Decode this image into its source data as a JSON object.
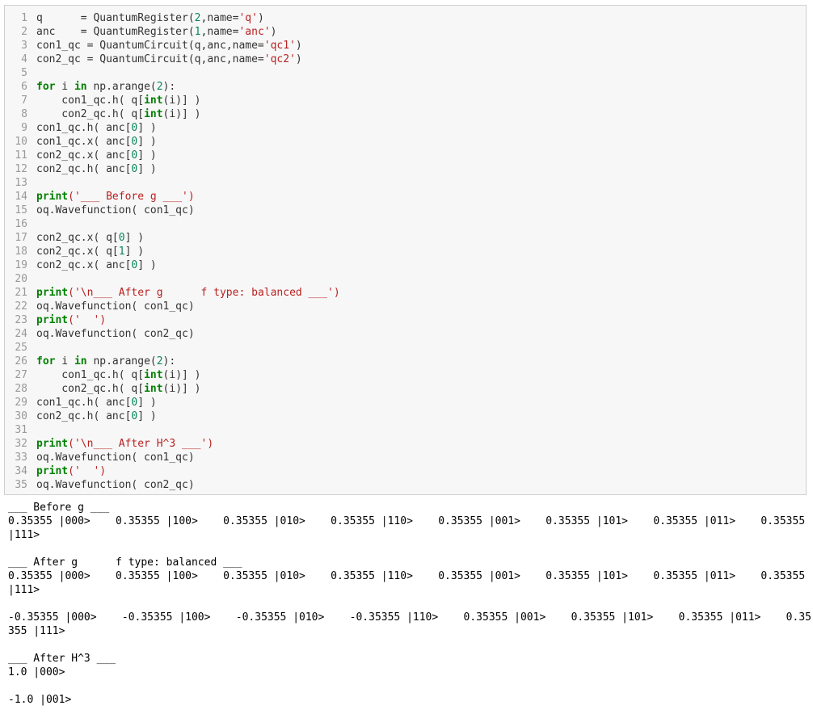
{
  "code_cell": {
    "lines": [
      {
        "n": "1",
        "tokens": [
          {
            "t": "q      = QuantumRegister(",
            "c": ""
          },
          {
            "t": "2",
            "c": "num"
          },
          {
            "t": ",name=",
            "c": ""
          },
          {
            "t": "'q'",
            "c": "str"
          },
          {
            "t": ")",
            "c": ""
          }
        ]
      },
      {
        "n": "2",
        "tokens": [
          {
            "t": "anc    = QuantumRegister(",
            "c": ""
          },
          {
            "t": "1",
            "c": "num"
          },
          {
            "t": ",name=",
            "c": ""
          },
          {
            "t": "'anc'",
            "c": "str"
          },
          {
            "t": ")",
            "c": ""
          }
        ]
      },
      {
        "n": "3",
        "tokens": [
          {
            "t": "con1_qc = QuantumCircuit(q,anc,name=",
            "c": ""
          },
          {
            "t": "'qc1'",
            "c": "str"
          },
          {
            "t": ")",
            "c": ""
          }
        ]
      },
      {
        "n": "4",
        "tokens": [
          {
            "t": "con2_qc = QuantumCircuit(q,anc,name=",
            "c": ""
          },
          {
            "t": "'qc2'",
            "c": "str"
          },
          {
            "t": ")",
            "c": ""
          }
        ]
      },
      {
        "n": "5",
        "tokens": []
      },
      {
        "n": "6",
        "tokens": [
          {
            "t": "for",
            "c": "kw"
          },
          {
            "t": " i ",
            "c": ""
          },
          {
            "t": "in",
            "c": "kw"
          },
          {
            "t": " np.arange(",
            "c": ""
          },
          {
            "t": "2",
            "c": "num"
          },
          {
            "t": "):",
            "c": ""
          }
        ]
      },
      {
        "n": "7",
        "tokens": [
          {
            "t": "    con1_qc.h( q[",
            "c": ""
          },
          {
            "t": "int",
            "c": "kw"
          },
          {
            "t": "(i)] )",
            "c": ""
          }
        ]
      },
      {
        "n": "8",
        "tokens": [
          {
            "t": "    con2_qc.h( q[",
            "c": ""
          },
          {
            "t": "int",
            "c": "kw"
          },
          {
            "t": "(i)] )",
            "c": ""
          }
        ]
      },
      {
        "n": "9",
        "tokens": [
          {
            "t": "con1_qc.h( anc[",
            "c": ""
          },
          {
            "t": "0",
            "c": "num"
          },
          {
            "t": "] )",
            "c": ""
          }
        ]
      },
      {
        "n": "10",
        "tokens": [
          {
            "t": "con1_qc.x( anc[",
            "c": ""
          },
          {
            "t": "0",
            "c": "num"
          },
          {
            "t": "] )",
            "c": ""
          }
        ]
      },
      {
        "n": "11",
        "tokens": [
          {
            "t": "con2_qc.x( anc[",
            "c": ""
          },
          {
            "t": "0",
            "c": "num"
          },
          {
            "t": "] )",
            "c": ""
          }
        ]
      },
      {
        "n": "12",
        "tokens": [
          {
            "t": "con2_qc.h( anc[",
            "c": ""
          },
          {
            "t": "0",
            "c": "num"
          },
          {
            "t": "] )",
            "c": ""
          }
        ]
      },
      {
        "n": "13",
        "tokens": []
      },
      {
        "n": "14",
        "tokens": [
          {
            "t": "print",
            "c": "kw"
          },
          {
            "t": "('___ Before g ___')",
            "c": "str"
          }
        ]
      },
      {
        "n": "15",
        "tokens": [
          {
            "t": "oq.Wavefunction( con1_qc)",
            "c": ""
          }
        ]
      },
      {
        "n": "16",
        "tokens": []
      },
      {
        "n": "17",
        "tokens": [
          {
            "t": "con2_qc.x( q[",
            "c": ""
          },
          {
            "t": "0",
            "c": "num"
          },
          {
            "t": "] )",
            "c": ""
          }
        ]
      },
      {
        "n": "18",
        "tokens": [
          {
            "t": "con2_qc.x( q[",
            "c": ""
          },
          {
            "t": "1",
            "c": "num"
          },
          {
            "t": "] )",
            "c": ""
          }
        ]
      },
      {
        "n": "19",
        "tokens": [
          {
            "t": "con2_qc.x( anc[",
            "c": ""
          },
          {
            "t": "0",
            "c": "num"
          },
          {
            "t": "] )",
            "c": ""
          }
        ]
      },
      {
        "n": "20",
        "tokens": []
      },
      {
        "n": "21",
        "tokens": [
          {
            "t": "print",
            "c": "kw"
          },
          {
            "t": "('\\n___ After g      f type: balanced ___')",
            "c": "str"
          }
        ]
      },
      {
        "n": "22",
        "tokens": [
          {
            "t": "oq.Wavefunction( con1_qc)",
            "c": ""
          }
        ]
      },
      {
        "n": "23",
        "tokens": [
          {
            "t": "print",
            "c": "kw"
          },
          {
            "t": "('  ')",
            "c": "str"
          }
        ]
      },
      {
        "n": "24",
        "tokens": [
          {
            "t": "oq.Wavefunction( con2_qc)",
            "c": ""
          }
        ]
      },
      {
        "n": "25",
        "tokens": []
      },
      {
        "n": "26",
        "tokens": [
          {
            "t": "for",
            "c": "kw"
          },
          {
            "t": " i ",
            "c": ""
          },
          {
            "t": "in",
            "c": "kw"
          },
          {
            "t": " np.arange(",
            "c": ""
          },
          {
            "t": "2",
            "c": "num"
          },
          {
            "t": "):",
            "c": ""
          }
        ]
      },
      {
        "n": "27",
        "tokens": [
          {
            "t": "    con1_qc.h( q[",
            "c": ""
          },
          {
            "t": "int",
            "c": "kw"
          },
          {
            "t": "(i)] )",
            "c": ""
          }
        ]
      },
      {
        "n": "28",
        "tokens": [
          {
            "t": "    con2_qc.h( q[",
            "c": ""
          },
          {
            "t": "int",
            "c": "kw"
          },
          {
            "t": "(i)] )",
            "c": ""
          }
        ]
      },
      {
        "n": "29",
        "tokens": [
          {
            "t": "con1_qc.h( anc[",
            "c": ""
          },
          {
            "t": "0",
            "c": "num"
          },
          {
            "t": "] )",
            "c": ""
          }
        ]
      },
      {
        "n": "30",
        "tokens": [
          {
            "t": "con2_qc.h( anc[",
            "c": ""
          },
          {
            "t": "0",
            "c": "num"
          },
          {
            "t": "] )",
            "c": ""
          }
        ]
      },
      {
        "n": "31",
        "tokens": []
      },
      {
        "n": "32",
        "tokens": [
          {
            "t": "print",
            "c": "kw"
          },
          {
            "t": "('\\n___ After H^3 ___')",
            "c": "str"
          }
        ]
      },
      {
        "n": "33",
        "tokens": [
          {
            "t": "oq.Wavefunction( con1_qc)",
            "c": ""
          }
        ]
      },
      {
        "n": "34",
        "tokens": [
          {
            "t": "print",
            "c": "kw"
          },
          {
            "t": "('  ')",
            "c": "str"
          }
        ]
      },
      {
        "n": "35",
        "tokens": [
          {
            "t": "oq.Wavefunction( con2_qc)",
            "c": ""
          }
        ]
      }
    ]
  },
  "output": {
    "lines": [
      "___ Before g ___",
      "0.35355 |000>    0.35355 |100>    0.35355 |010>    0.35355 |110>    0.35355 |001>    0.35355 |101>    0.35355 |011>    0.35355",
      "|111>",
      "",
      "___ After g      f type: balanced ___",
      "0.35355 |000>    0.35355 |100>    0.35355 |010>    0.35355 |110>    0.35355 |001>    0.35355 |101>    0.35355 |011>    0.35355",
      "|111>",
      "",
      "-0.35355 |000>    -0.35355 |100>    -0.35355 |010>    -0.35355 |110>    0.35355 |001>    0.35355 |101>    0.35355 |011>    0.35",
      "355 |111>",
      "",
      "___ After H^3 ___",
      "1.0 |000>",
      "",
      "-1.0 |001>"
    ]
  }
}
